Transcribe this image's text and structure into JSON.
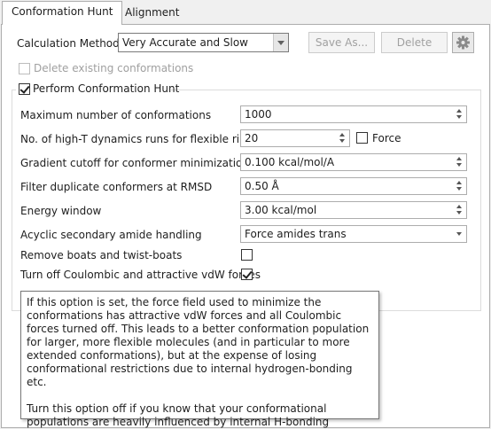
{
  "tabs": [
    {
      "label": "Conformation Hunt",
      "active": true
    },
    {
      "label": "Alignment",
      "active": false
    }
  ],
  "calculation_method": {
    "label": "Calculation Method:",
    "value": "Very Accurate and Slow"
  },
  "buttons": {
    "save_as": "Save As...",
    "delete": "Delete"
  },
  "delete_existing": {
    "label": "Delete existing conformations",
    "checked": false,
    "enabled": false
  },
  "perform_hunt": {
    "label": "Perform Conformation Hunt",
    "checked": true
  },
  "settings": {
    "max_conformations": {
      "label": "Maximum number of conformations",
      "value": "1000"
    },
    "high_t_runs": {
      "label": "No. of high-T dynamics runs for flexible rings",
      "value": "20"
    },
    "force": {
      "label": "Force",
      "checked": false
    },
    "gradient_cutoff": {
      "label": "Gradient cutoff for conformer minimization",
      "value": "0.100 kcal/mol/A"
    },
    "filter_rmsd": {
      "label": "Filter duplicate conformers at RMSD",
      "value": "0.50 Å"
    },
    "energy_window": {
      "label": "Energy window",
      "value": "3.00 kcal/mol"
    },
    "amide_handling": {
      "label": "Acyclic secondary amide handling",
      "value": "Force amides trans"
    },
    "remove_boats": {
      "label": "Remove boats and twist-boats",
      "checked": false
    },
    "coulombic_off": {
      "label": "Turn off Coulombic and attractive vdW forces",
      "checked": true
    }
  },
  "tooltip": {
    "p1": "If this option is set, the force field used to minimize the conformations has attractive vdW forces and all Coulombic forces turned off. This leads to a better conformation population for larger, more flexible molecules (and in particular to more extended conformations), but at the expense of losing conformational restrictions due to internal hydrogen-bonding etc.",
    "p2": "Turn this option off if you know that your conformational populations are heavily influenced by internal H-bonding restrictions, otherwise it is recommended that you leave it on."
  },
  "icons": {
    "settings": "gear-icon",
    "dropdown": "chevron-down-icon",
    "spinner": "spinner-arrows-icon"
  }
}
